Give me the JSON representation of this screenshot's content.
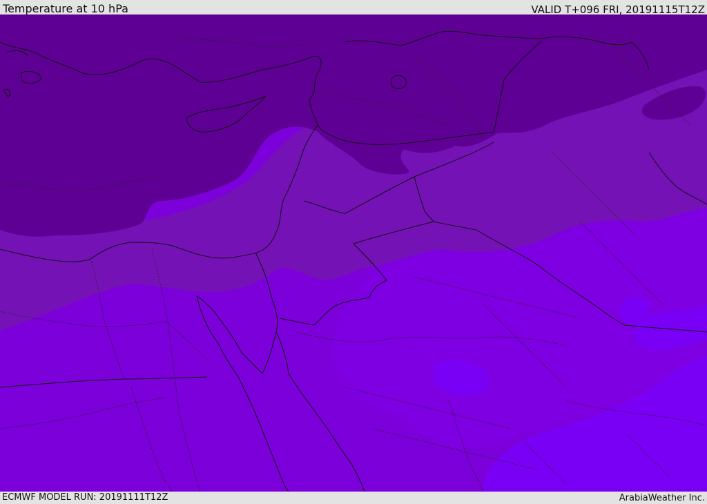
{
  "header": {
    "title": "Temperature at 10 hPa",
    "valid_time": "VALID T+096 FRI, 20191115T12Z"
  },
  "footer": {
    "model_run": "ECMWF MODEL RUN: 20191111T12Z",
    "credit": "ArabiaWeather Inc."
  },
  "map": {
    "variable": "temperature",
    "level": "10 hPa",
    "colors": {
      "coldest_band": "#5f0095",
      "cold_band": "#7411b6",
      "mid_band": "#7d00d9",
      "warm_band": "#8000e6",
      "warmest_band": "#7a00f5",
      "coastline": "#111111",
      "border": "#111111"
    }
  }
}
